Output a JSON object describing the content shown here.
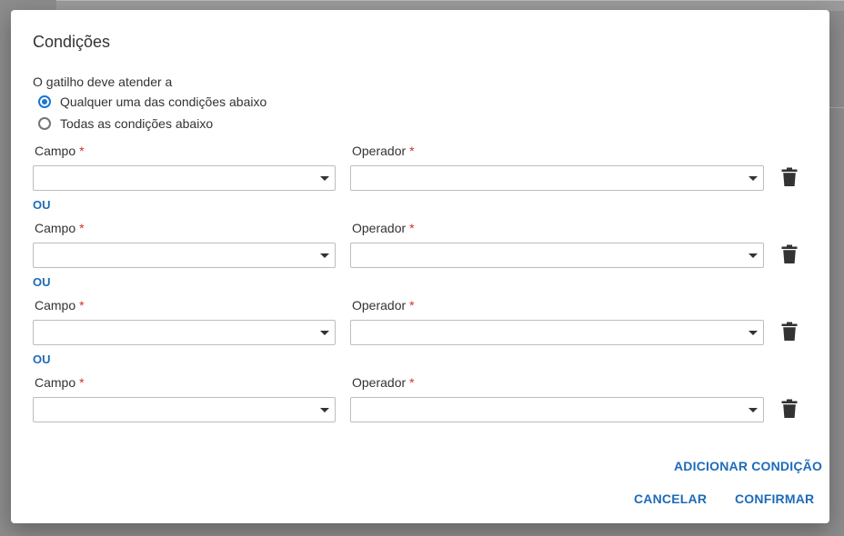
{
  "dialog": {
    "title": "Condições",
    "trigger_label": "O gatilho deve atender a",
    "options": [
      {
        "label": "Qualquer uma das condições abaixo",
        "checked": true
      },
      {
        "label": "Todas as condições abaixo",
        "checked": false
      }
    ],
    "conditions": [
      {
        "field_label": "Campo",
        "operator_label": "Operador",
        "required_mark": "*",
        "field_value": "",
        "operator_value": ""
      },
      {
        "field_label": "Campo",
        "operator_label": "Operador",
        "required_mark": "*",
        "field_value": "",
        "operator_value": ""
      },
      {
        "field_label": "Campo",
        "operator_label": "Operador",
        "required_mark": "*",
        "field_value": "",
        "operator_value": ""
      },
      {
        "field_label": "Campo",
        "operator_label": "Operador",
        "required_mark": "*",
        "field_value": "",
        "operator_value": ""
      }
    ],
    "separator": "OU",
    "add_condition_label": "ADICIONAR CONDIÇÃO",
    "cancel_label": "CANCELAR",
    "confirm_label": "CONFIRMAR",
    "icons": {
      "trash": "trash-icon",
      "dropdown": "chevron-down-icon"
    },
    "colors": {
      "accent": "#1e6bb8",
      "radio": "#1976d2",
      "required": "#d32f2f"
    }
  }
}
